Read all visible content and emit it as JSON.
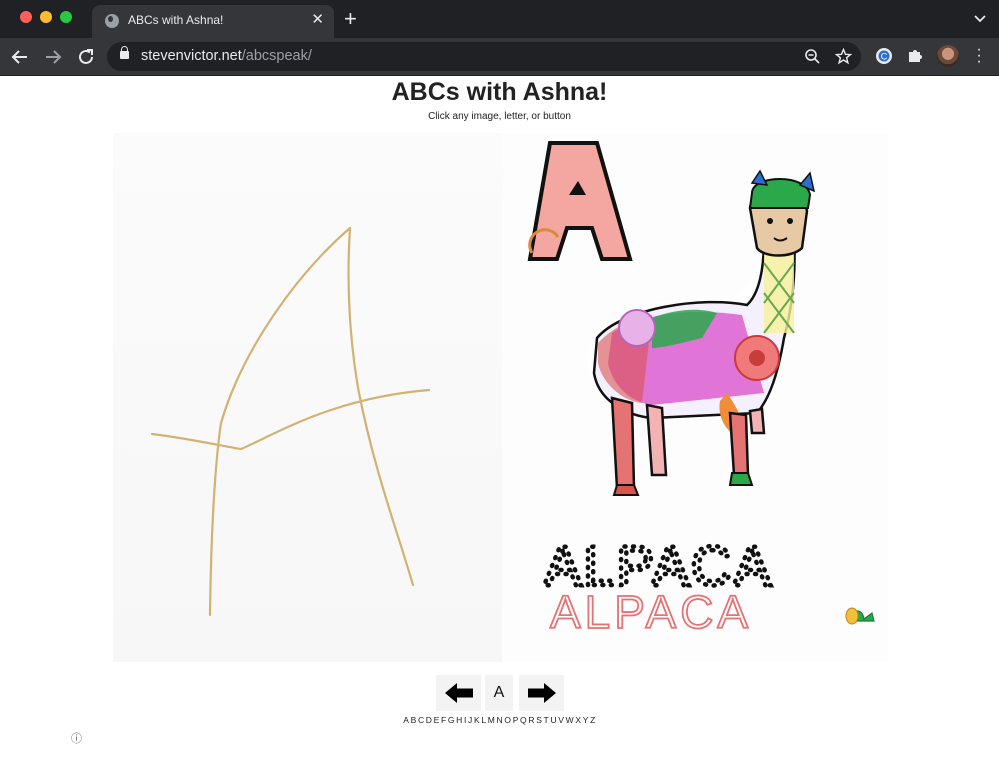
{
  "browser": {
    "tab_title": "ABCs with Ashna!",
    "tab_close": "✕",
    "new_tab": "+",
    "url_domain": "stevenvictor.net",
    "url_path": "/abcspeak/"
  },
  "page": {
    "title": "ABCs with Ashna!",
    "subtitle": "Click any image, letter, or button",
    "current_letter": "A",
    "word_outline": "ALPACA",
    "word_traced": "ALPACA",
    "info": "ⓘ"
  },
  "alphabet": [
    "A",
    "B",
    "C",
    "D",
    "E",
    "F",
    "G",
    "H",
    "I",
    "J",
    "K",
    "L",
    "M",
    "N",
    "O",
    "P",
    "Q",
    "R",
    "S",
    "T",
    "U",
    "V",
    "W",
    "X",
    "Y",
    "Z"
  ],
  "colors": {
    "chrome_dark": "#202124",
    "chrome_tab": "#35363a",
    "pencil": "#d2b273",
    "crayon_red": "#d9534f",
    "crayon_green": "#2aa84a",
    "crayon_magenta": "#d94bc9",
    "crayon_orange": "#f08c3a"
  },
  "icons": {
    "back": "arrow-left-icon",
    "forward": "arrow-right-icon",
    "reload": "reload-icon",
    "zoom": "zoom-out-icon",
    "bookmark": "star-icon",
    "extensions": "puzzle-icon",
    "menu": "kebab-icon"
  }
}
